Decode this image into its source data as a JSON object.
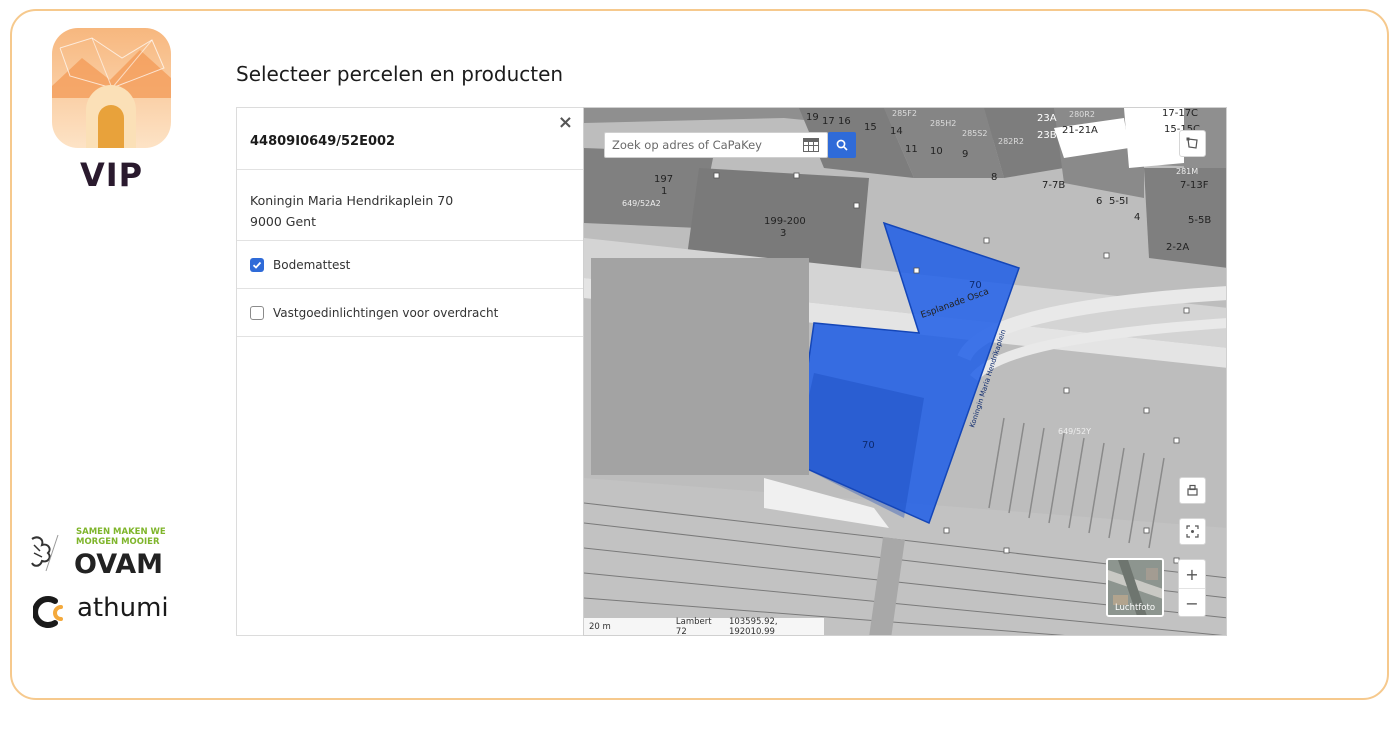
{
  "brand": {
    "app_name": "VIP",
    "ovam_tagline_1": "SAMEN MAKEN WE",
    "ovam_tagline_2": "MORGEN MOOIER",
    "ovam_name": "OVAM",
    "athumi_name": "athumi"
  },
  "page": {
    "title": "Selecteer percelen en producten"
  },
  "panel": {
    "parcel_id": "44809I0649/52E002",
    "close_label": "×",
    "address_line1": "Koningin Maria Hendrikaplein 70",
    "address_line2": "9000 Gent",
    "products": [
      {
        "label": "Bodemattest",
        "checked": true
      },
      {
        "label": "Vastgoedinlichtingen voor overdracht",
        "checked": false
      }
    ]
  },
  "map": {
    "search_placeholder": "Zoek op adres of CaPaKey",
    "aerial_label": "Luchtfoto",
    "zoom_in": "+",
    "zoom_out": "−",
    "scale_text": "20 m",
    "projection": "Lambert 72",
    "coordinates": "103595.92, 192010.99",
    "accent_color": "#2f6bd8",
    "parcel_fill": "#1f5ee8",
    "labels": {
      "street_1": "Esplanade Osca",
      "street_2": "Koningin Maria Hendrikaplein",
      "p_70_a": "70",
      "p_70_b": "70",
      "p_197": "197",
      "p_1": "1",
      "p_649_52a2": "649/52A2",
      "p_199_200": "199-200",
      "p_3": "3",
      "p_649_52y": "649/52Y",
      "p_19": "19",
      "p_17": "17",
      "p_16": "16",
      "p_15": "15",
      "p_14": "14",
      "p_11": "11",
      "p_10": "10",
      "p_9": "9",
      "p_8": "8",
      "p_23a": "23A",
      "p_23b": "23B",
      "p_21_21a": "21-21A",
      "p_7_7b": "7-7B",
      "p_6": "6",
      "p_5_5i": "5-5I",
      "p_4": "4",
      "p_7_13f": "7-13F",
      "p_5_5b": "5-5B",
      "p_2_2a": "2-2A",
      "p_15_15c": "15-15C",
      "p_17_17c": "17-17C",
      "p_280r2": "280R2",
      "p_285f2": "285F2",
      "p_285h2": "285H2",
      "p_285s2": "285S2",
      "p_282r2": "282R2",
      "p_281m": "281M"
    }
  }
}
